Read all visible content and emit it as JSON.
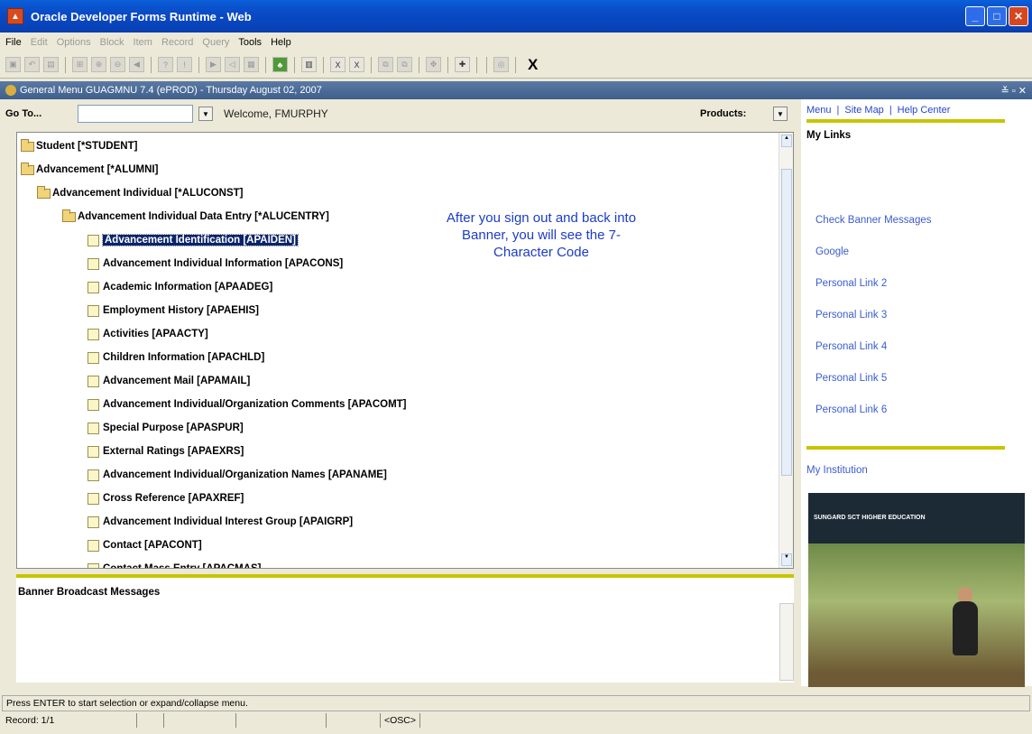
{
  "window": {
    "title": "Oracle Developer Forms Runtime - Web"
  },
  "menu": {
    "items": [
      "File",
      "Edit",
      "Options",
      "Block",
      "Item",
      "Record",
      "Query",
      "Tools",
      "Help"
    ]
  },
  "form": {
    "title": "General Menu GUAGMNU 7.4 (ePROD) - Thursday August 02, 2007"
  },
  "goto": {
    "label": "Go To...",
    "welcome": "Welcome, FMURPHY",
    "products": "Products:"
  },
  "tree": [
    {
      "label": "Student [*STUDENT]",
      "type": "folder",
      "indent": 0
    },
    {
      "label": "Advancement [*ALUMNI]",
      "type": "folder",
      "indent": 0
    },
    {
      "label": "Advancement Individual [*ALUCONST]",
      "type": "folder",
      "indent": 1
    },
    {
      "label": "Advancement Individual Data Entry [*ALUCENTRY]",
      "type": "folder",
      "indent": 2
    },
    {
      "label": "Advancement Identification [APAIDEN]",
      "type": "doc",
      "indent": 3,
      "selected": true
    },
    {
      "label": "Advancement Individual Information [APACONS]",
      "type": "doc",
      "indent": 3
    },
    {
      "label": "Academic Information [APAADEG]",
      "type": "doc",
      "indent": 3
    },
    {
      "label": "Employment History [APAEHIS]",
      "type": "doc",
      "indent": 3
    },
    {
      "label": "Activities [APAACTY]",
      "type": "doc",
      "indent": 3
    },
    {
      "label": "Children Information [APACHLD]",
      "type": "doc",
      "indent": 3
    },
    {
      "label": "Advancement Mail [APAMAIL]",
      "type": "doc",
      "indent": 3
    },
    {
      "label": "Advancement Individual/Organization Comments [APACOMT]",
      "type": "doc",
      "indent": 3
    },
    {
      "label": "Special Purpose [APASPUR]",
      "type": "doc",
      "indent": 3
    },
    {
      "label": "External Ratings [APAEXRS]",
      "type": "doc",
      "indent": 3
    },
    {
      "label": "Advancement Individual/Organization Names [APANAME]",
      "type": "doc",
      "indent": 3
    },
    {
      "label": "Cross Reference [APAXREF]",
      "type": "doc",
      "indent": 3
    },
    {
      "label": "Advancement Individual Interest Group [APAIGRP]",
      "type": "doc",
      "indent": 3
    },
    {
      "label": "Contact [APACONT]",
      "type": "doc",
      "indent": 3
    },
    {
      "label": "Contact Mass Entry [APACMAS]",
      "type": "doc",
      "indent": 3
    }
  ],
  "annotation": "After you sign out and back into Banner, you will see the 7-Character Code",
  "right_panel": {
    "top_links": [
      "Menu",
      "Site Map",
      "Help Center"
    ],
    "my_links_title": "My Links",
    "links": [
      "Check Banner Messages",
      "Google",
      "Personal Link 2",
      "Personal Link 3",
      "Personal Link 4",
      "Personal Link 5",
      "Personal Link 6"
    ],
    "institution": "My Institution",
    "brand": "SUNGARD SCT HIGHER EDUCATION"
  },
  "broadcast": {
    "title": "Banner Broadcast Messages"
  },
  "status": {
    "message": "Press ENTER to start selection or expand/collapse menu.",
    "record": "Record: 1/1",
    "mode": "<OSC>"
  }
}
